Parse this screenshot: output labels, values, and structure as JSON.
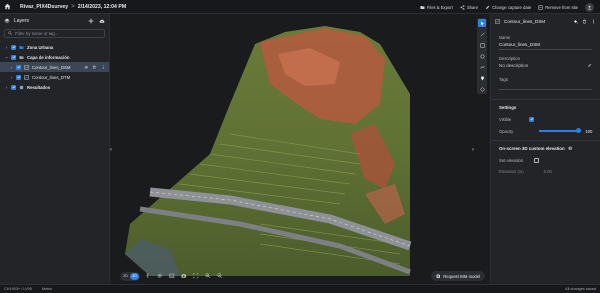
{
  "topbar": {
    "breadcrumb_project": "Rivaz_PIX4Dsurvey",
    "breadcrumb_sep": ">",
    "breadcrumb_date": "2/14/2023, 12:04 PM",
    "actions": {
      "files_export": "Files & Export",
      "share": "Share",
      "change_capture_date": "Change capture date",
      "remove_from_site": "Remove from site"
    }
  },
  "layers": {
    "title": "Layers",
    "filter_placeholder": "Filter by name or tag...",
    "items": [
      {
        "label": "Zona Urbana"
      },
      {
        "label": "Capa de información"
      },
      {
        "label": "Contour_lines_DSM"
      },
      {
        "label": "Contour_lines_DTM"
      },
      {
        "label": "Resultados"
      }
    ]
  },
  "viewport": {
    "mode_2d": "2D",
    "mode_3d": "3D",
    "bim_button": "Request BIM model"
  },
  "properties": {
    "title": "Contour_lines_DSM",
    "name_label": "Name",
    "name_value": "Contour_lines_DSM",
    "description_label": "Description",
    "description_value": "No description",
    "tags_label": "Tags",
    "settings_title": "Settings",
    "visible_label": "Visible",
    "opacity_label": "Opacity",
    "opacity_value": "100",
    "on_screen_title": "On-screen 3D custom elevation",
    "set_elevation_label": "Set elevation",
    "elevation_label": "Elevation (m)",
    "elevation_value": "0.00"
  },
  "statusbar": {
    "crs": "CH1903+ / LV95",
    "units": "Metric",
    "saved": "All changes saved"
  }
}
